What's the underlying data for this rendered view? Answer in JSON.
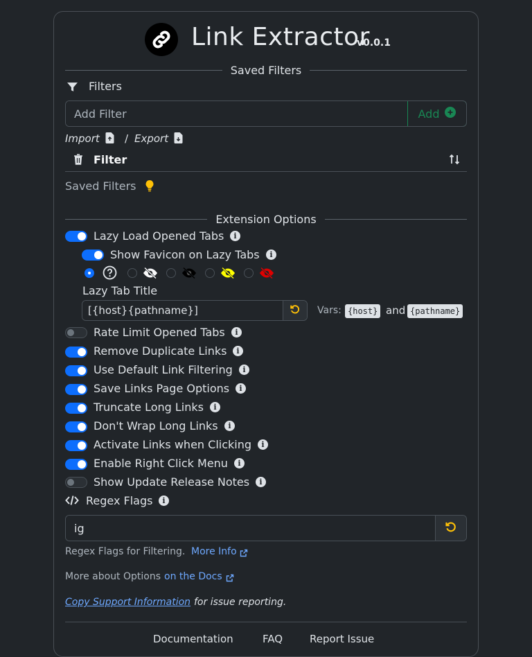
{
  "app": {
    "title": "Link Extractor",
    "version": "v0.0.1"
  },
  "saved_filters_section": {
    "heading": "Saved Filters",
    "filters_label": "Filters",
    "add_filter_placeholder": "Add Filter",
    "add_button_label": "Add",
    "import_label": "Import",
    "separator": "/",
    "export_label": "Export",
    "table_header_filter": "Filter",
    "empty_text": "Saved Filters"
  },
  "extension_options": {
    "heading": "Extension Options",
    "lazy_load": {
      "label": "Lazy Load Opened Tabs",
      "enabled": true
    },
    "show_favicon": {
      "label": "Show Favicon on Lazy Tabs",
      "enabled": true
    },
    "favicon_options": [
      "question-circle-icon",
      "eye-slash-white-icon",
      "eye-slash-black-icon",
      "eye-slash-yellow-icon",
      "eye-slash-red-icon"
    ],
    "lazy_tab_title": {
      "label": "Lazy Tab Title",
      "value": "[{host}{pathname}]",
      "vars_label": "Vars:",
      "var_host": "{host}",
      "and_label": "and",
      "var_pathname": "{pathname}"
    },
    "toggles": [
      {
        "label": "Rate Limit Opened Tabs",
        "enabled": false
      },
      {
        "label": "Remove Duplicate Links",
        "enabled": true
      },
      {
        "label": "Use Default Link Filtering",
        "enabled": true
      },
      {
        "label": "Save Links Page Options",
        "enabled": true
      },
      {
        "label": "Truncate Long Links",
        "enabled": true
      },
      {
        "label": "Don't Wrap Long Links",
        "enabled": true
      },
      {
        "label": "Activate Links when Clicking",
        "enabled": true
      },
      {
        "label": "Enable Right Click Menu",
        "enabled": true
      },
      {
        "label": "Show Update Release Notes",
        "enabled": false
      }
    ],
    "regex_flags": {
      "label": "Regex Flags",
      "value": "ig",
      "help_text": "Regex Flags for Filtering.",
      "more_info_link": "More Info"
    },
    "more_about_text": "More about Options",
    "docs_link": "on the Docs",
    "copy_support_link": "Copy Support Information",
    "copy_support_suffix": "for issue reporting."
  },
  "footer": {
    "links": [
      "Documentation",
      "FAQ",
      "Report Issue"
    ]
  },
  "colors": {
    "accent": "#0d6efd",
    "success": "#198754",
    "warning": "#ffc107",
    "link": "#6ea8fe",
    "background": "#212529"
  }
}
